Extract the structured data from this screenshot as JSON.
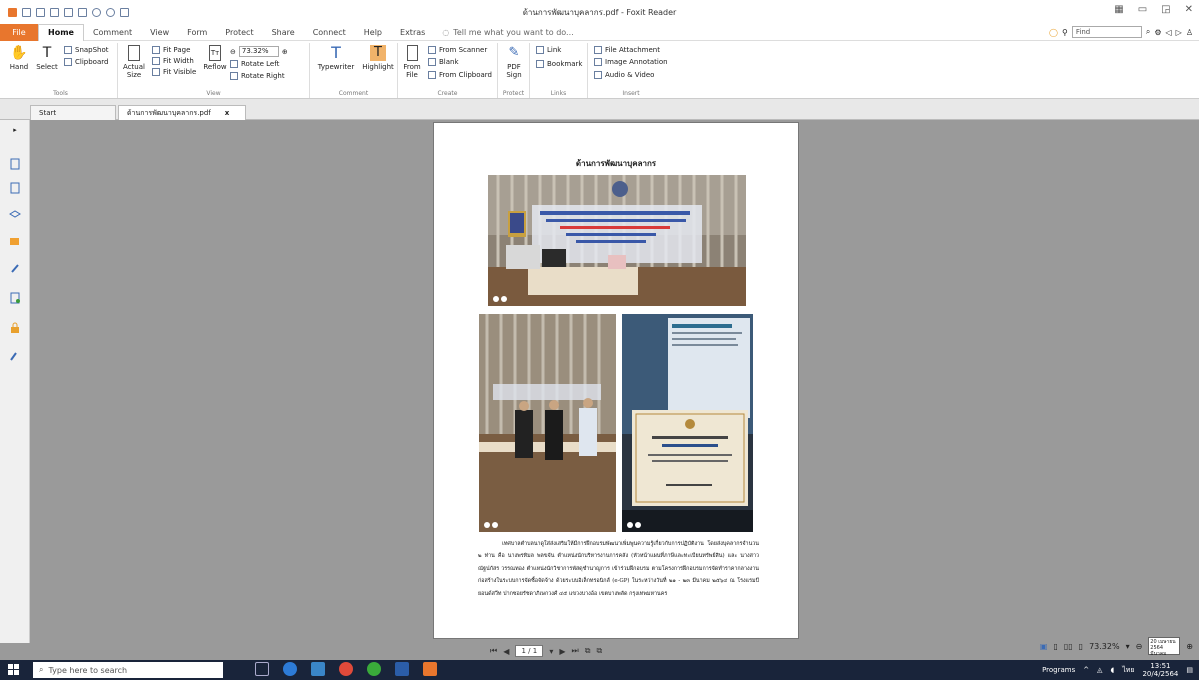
{
  "window": {
    "title": "ด้านการพัฒนาบุคลากร.pdf - Foxit Reader"
  },
  "menu": {
    "file": "File",
    "tabs": [
      "Home",
      "Comment",
      "View",
      "Form",
      "Protect",
      "Share",
      "Connect",
      "Help",
      "Extras"
    ],
    "tell_me": "Tell me what you want to do...",
    "find_placeholder": "Find"
  },
  "ribbon": {
    "tools": {
      "hand": "Hand",
      "select": "Select",
      "snapshot": "SnapShot",
      "clipboard": "Clipboard",
      "label": "Tools"
    },
    "view": {
      "actual_size_1": "Actual",
      "actual_size_2": "Size",
      "fit_page": "Fit Page",
      "fit_width": "Fit Width",
      "fit_visible": "Fit Visible",
      "reflow": "Reflow",
      "zoom": "73.32%",
      "rotate_left": "Rotate Left",
      "rotate_right": "Rotate Right",
      "label": "View"
    },
    "comment": {
      "typewriter": "Typewriter",
      "highlight": "Highlight",
      "label": "Comment"
    },
    "create": {
      "from_file_1": "From",
      "from_file_2": "File",
      "from_scanner": "From Scanner",
      "blank": "Blank",
      "from_clipboard": "From Clipboard",
      "label": "Create"
    },
    "protect": {
      "pdf_sign_1": "PDF",
      "pdf_sign_2": "Sign",
      "label": "Protect"
    },
    "links": {
      "link": "Link",
      "bookmark": "Bookmark",
      "label": "Links"
    },
    "insert": {
      "file_attachment": "File Attachment",
      "image_annotation": "Image Annotation",
      "audio_video": "Audio & Video",
      "label": "Insert"
    }
  },
  "doc_tabs": {
    "start": "Start",
    "active": "ด้านการพัฒนาบุคลากร.pdf",
    "close": "x"
  },
  "page": {
    "heading": "ด้านการพัฒนาบุคลากร",
    "body": "เทศบาลตำบลนาดูใส่ส่งเสริมให้มีการฝึกอบรมพัฒนาเพิ่มพูนความรู้เกี่ยวกับการปฏิบัติงาน โดยส่งบุคลากรจำนวน ๒ ท่าน คือ นางพรทิมล พลขจัน ตำแหน่งนักบริหารงานการคลัง (หัวหน้าแผนที่ภาษีและทะเบียนทรัพย์สิน) และ นางสาวณัฐปภัสร วรรณทอง ตำแหน่งนักวิชาการพัสดุชำนาญการ เข้าร่วมฝึกอบรม ตามโครงการฝึกอบรมการจัดทำราคากลางงานก่อสร้างในระบบการจัดซื้อจัดจ้าง ด้วยระบบอิเล็กทรอนิกส์ (e-GP) ในระหว่างวันที่ ๒๑ - ๒๓ มีนาคม ๒๕๖๔ ณ โรงแรมบียอนด์สวีท ปากซอยรัชดาภิเษกวงศ์ ๔๕ แขวงบางอ้อ เขตบางพลัด กรุงเทพมหานคร"
  },
  "nav": {
    "page_display": "1 / 1"
  },
  "status": {
    "zoom": "73.32%",
    "date_line1": "20 เมษายน 2564",
    "date_line2": "มีนาคม"
  },
  "taskbar": {
    "search_placeholder": "Type here to search",
    "programs": "Programs",
    "time": "13:51",
    "date": "20/4/2564",
    "lang": "ไทย"
  },
  "colors": {
    "accent": "#e8762d",
    "taskbar": "#19243a",
    "workspace": "#9a9a9a"
  }
}
